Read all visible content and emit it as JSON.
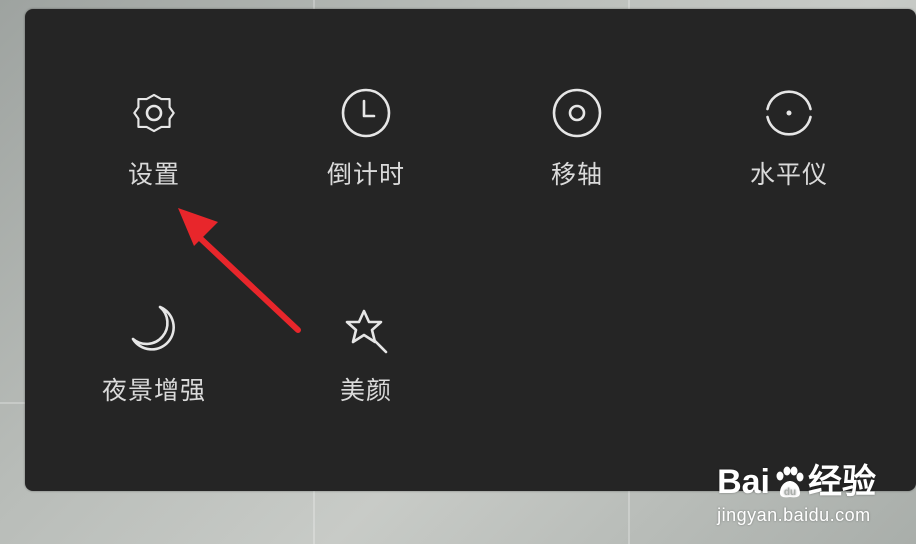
{
  "panel": {
    "items": [
      {
        "label": "设置",
        "icon": "gear-icon"
      },
      {
        "label": "倒计时",
        "icon": "clock-icon"
      },
      {
        "label": "移轴",
        "icon": "tilt-shift-icon"
      },
      {
        "label": "水平仪",
        "icon": "level-icon"
      },
      {
        "label": "夜景增强",
        "icon": "moon-icon"
      },
      {
        "label": "美颜",
        "icon": "magic-wand-icon"
      }
    ]
  },
  "annotation": {
    "arrow_color": "#e8262b",
    "arrow_target": "设置"
  },
  "watermark": {
    "brand_left": "Bai",
    "brand_right": "经验",
    "url": "jingyan.baidu.com"
  }
}
